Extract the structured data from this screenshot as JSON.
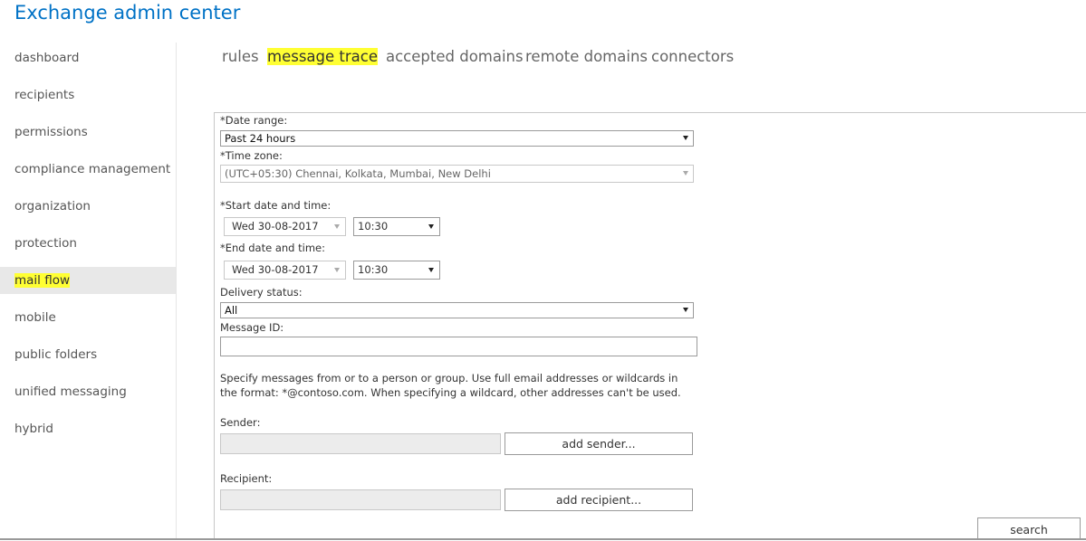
{
  "app": {
    "title": "Exchange admin center"
  },
  "sidebar": {
    "items": [
      {
        "label": "dashboard"
      },
      {
        "label": "recipients"
      },
      {
        "label": "permissions"
      },
      {
        "label": "compliance management"
      },
      {
        "label": "organization"
      },
      {
        "label": "protection"
      },
      {
        "label": "mail flow",
        "selected": true
      },
      {
        "label": "mobile"
      },
      {
        "label": "public folders"
      },
      {
        "label": "unified messaging"
      },
      {
        "label": "hybrid"
      }
    ]
  },
  "tabs": [
    {
      "label": "rules"
    },
    {
      "label": "message trace",
      "active": true
    },
    {
      "label": "accepted domains"
    },
    {
      "label": "remote domains"
    },
    {
      "label": "connectors"
    }
  ],
  "form": {
    "date_range": {
      "label": "*Date range:",
      "value": "Past 24 hours"
    },
    "time_zone": {
      "label": "*Time zone:",
      "value": "(UTC+05:30) Chennai, Kolkata, Mumbai, New Delhi"
    },
    "start": {
      "label": "*Start date and time:",
      "date": "Wed 30-08-2017",
      "time": "10:30"
    },
    "end": {
      "label": "*End date and time:",
      "date": "Wed 30-08-2017",
      "time": "10:30"
    },
    "delivery_status": {
      "label": "Delivery status:",
      "value": "All"
    },
    "message_id": {
      "label": "Message ID:",
      "value": ""
    },
    "hint": "Specify messages from or to a person or group. Use full email addresses or wildcards in the format: *@contoso.com. When specifying a wildcard, other addresses can't be used.",
    "sender": {
      "label": "Sender:",
      "button": "add sender..."
    },
    "recipient": {
      "label": "Recipient:",
      "button": "add recipient..."
    },
    "search_button": "search"
  },
  "colors": {
    "brand": "#0072c6",
    "highlight": "#ffff33",
    "selected_bg": "#e8e8e8"
  }
}
